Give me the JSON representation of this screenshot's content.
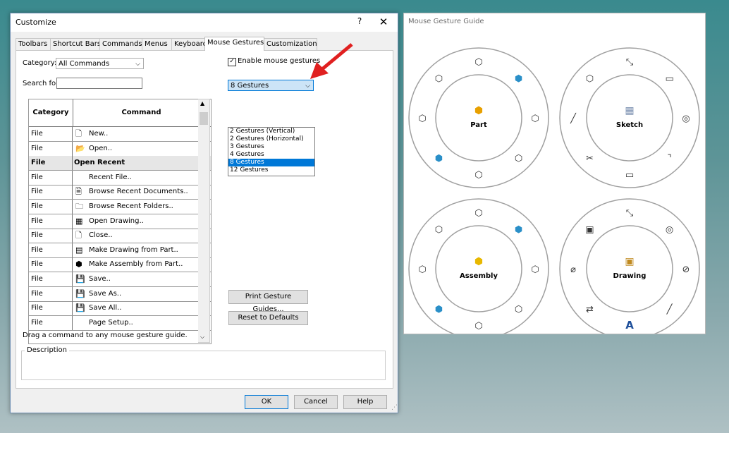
{
  "dialog": {
    "title": "Customize",
    "help_glyph": "?",
    "close_glyph": "✕",
    "tabs": [
      "Toolbars",
      "Shortcut Bars",
      "Commands",
      "Menus",
      "Keyboard",
      "Mouse Gestures",
      "Customization"
    ],
    "active_tab": "Mouse Gestures",
    "category_label": "Category:",
    "category_value": "All Commands",
    "search_label": "Search for:",
    "search_value": "",
    "table": {
      "headers": [
        "Category",
        "Command"
      ],
      "rows": [
        {
          "category": "File",
          "command": "New..",
          "icon": "new-document-icon"
        },
        {
          "category": "File",
          "command": "Open..",
          "icon": "open-folder-icon"
        },
        {
          "category": "File",
          "command": "Open Recent",
          "icon": "",
          "selected": true
        },
        {
          "category": "File",
          "command": "Recent File..",
          "icon": ""
        },
        {
          "category": "File",
          "command": "Browse Recent Documents..",
          "icon": "recent-documents-icon"
        },
        {
          "category": "File",
          "command": "Browse Recent Folders..",
          "icon": "recent-folders-icon"
        },
        {
          "category": "File",
          "command": "Open Drawing..",
          "icon": "open-drawing-icon"
        },
        {
          "category": "File",
          "command": "Close..",
          "icon": "close-document-icon"
        },
        {
          "category": "File",
          "command": "Make Drawing from Part..",
          "icon": "make-drawing-icon"
        },
        {
          "category": "File",
          "command": "Make Assembly from Part..",
          "icon": "make-assembly-icon"
        },
        {
          "category": "File",
          "command": "Save..",
          "icon": "save-icon"
        },
        {
          "category": "File",
          "command": "Save As..",
          "icon": "save-as-icon"
        },
        {
          "category": "File",
          "command": "Save All..",
          "icon": "save-all-icon"
        },
        {
          "category": "File",
          "command": "Page Setup..",
          "icon": ""
        }
      ]
    },
    "enable_label": "Enable mouse gestures",
    "enable_checked": true,
    "gestures_value": "8 Gestures",
    "gesture_options": [
      "2 Gestures (Vertical)",
      "2 Gestures (Horizontal)",
      "3 Gestures",
      "4 Gestures",
      "8 Gestures",
      "12 Gestures"
    ],
    "print_button": "Print Gesture Guides...",
    "reset_button": "Reset to Defaults",
    "drag_hint": "Drag a command to any mouse gesture guide.",
    "description_label": "Description",
    "ok_button": "OK",
    "cancel_button": "Cancel",
    "help_button": "Help"
  },
  "guide": {
    "title": "Mouse Gesture Guide",
    "wheels": [
      {
        "label": "Part"
      },
      {
        "label": "Sketch"
      },
      {
        "label": "Assembly"
      },
      {
        "label": "Drawing"
      }
    ]
  },
  "colors": {
    "accent": "#0078d7",
    "arrow": "#e02020"
  }
}
